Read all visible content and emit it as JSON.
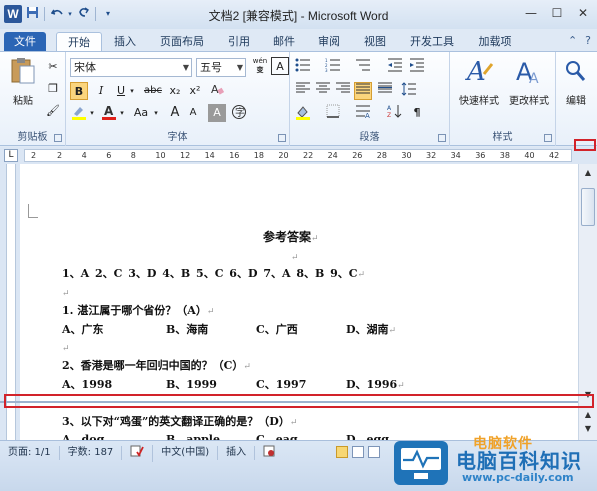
{
  "window": {
    "title": "文档2 [兼容模式] - Microsoft Word",
    "logo_letter": "W",
    "qat": {
      "save_icon": "save-icon",
      "undo_icon": "undo-icon",
      "redo_icon": "redo-icon",
      "customize_icon": "dropdown-icon"
    },
    "controls": {
      "minimize": "—",
      "maximize": "☐",
      "close": "✕"
    }
  },
  "tabs": [
    {
      "label": "文件"
    },
    {
      "label": "开始"
    },
    {
      "label": "插入"
    },
    {
      "label": "页面布局"
    },
    {
      "label": "引用"
    },
    {
      "label": "邮件"
    },
    {
      "label": "审阅"
    },
    {
      "label": "视图"
    },
    {
      "label": "开发工具"
    },
    {
      "label": "加载项"
    }
  ],
  "active_tab": "开始",
  "ribbon": {
    "clipboard": {
      "label": "剪贴板",
      "paste_label": "粘贴"
    },
    "font": {
      "label": "字体",
      "font_name": "宋体",
      "font_size": "五号",
      "wen_label": "wén",
      "wen_char": "变",
      "a_char": "A",
      "bold": "B",
      "italic": "I",
      "underline": "U",
      "strike": "abc",
      "subscript": "x₂",
      "superscript": "x²",
      "change_case": "Aa",
      "grow_font": "A",
      "shrink_font": "A"
    },
    "paragraph": {
      "label": "段落"
    },
    "styles": {
      "label": "样式",
      "quick_styles": "快速样式",
      "change_styles": "更改样式"
    },
    "editing": {
      "label": "编辑"
    }
  },
  "ruler": {
    "ticks": [
      "2",
      "2",
      "4",
      "6",
      "8",
      "10",
      "12",
      "14",
      "16",
      "18",
      "20",
      "22",
      "24",
      "26",
      "28",
      "30",
      "32",
      "34",
      "36",
      "38",
      "40",
      "42"
    ]
  },
  "document": {
    "heading": "参考答案",
    "answers": "1、A  2、C  3、D  4、B  5、C  6、D  7、A  8、B  9、C",
    "questions": [
      {
        "q": "1.   湛江属于哪个省份？（A）",
        "options": [
          "A、广东",
          "B、海南",
          "C、广西",
          "D、湖南"
        ]
      },
      {
        "q": "2、香港是哪一年回归中国的？（C）",
        "options": [
          "A、1998",
          "B、1999",
          "C、1997",
          "D、1996"
        ]
      },
      {
        "q": "3、以下对“鸡蛋”的英文翻译正确的是？（D）",
        "options": [
          "A、dog",
          "B、apple",
          "C、eag",
          "D、egg"
        ]
      }
    ],
    "para_mark": "↵"
  },
  "status": {
    "page": "页面: 1/1",
    "words": "字数: 187",
    "language": "中文(中国)",
    "mode": "插入"
  },
  "watermark": {
    "small": "电脑软件",
    "big": "电脑百科知识",
    "url": "www.pc-daily.com"
  },
  "colors": {
    "accent": "#2a65b5",
    "highlight": "#d2232a"
  }
}
